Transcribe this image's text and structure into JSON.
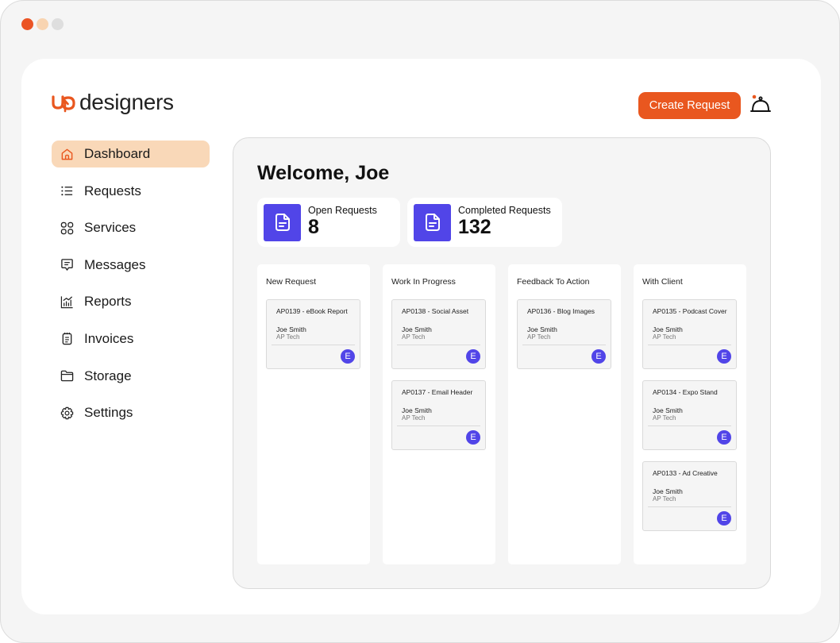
{
  "window": {
    "controls": [
      "close",
      "minimize",
      "maximize"
    ]
  },
  "brand": {
    "name": "designers",
    "mark": "up",
    "accent_color": "#e9571f",
    "primary_color": "#5145e8"
  },
  "header": {
    "create_button_label": "Create Request",
    "notification_icon": "service-bell-icon",
    "has_notification": true
  },
  "sidebar": {
    "items": [
      {
        "label": "Dashboard",
        "icon": "home-icon",
        "active": true
      },
      {
        "label": "Requests",
        "icon": "list-icon",
        "active": false
      },
      {
        "label": "Services",
        "icon": "grid-icon",
        "active": false
      },
      {
        "label": "Messages",
        "icon": "message-icon",
        "active": false
      },
      {
        "label": "Reports",
        "icon": "chart-icon",
        "active": false
      },
      {
        "label": "Invoices",
        "icon": "invoice-icon",
        "active": false
      },
      {
        "label": "Storage",
        "icon": "folder-icon",
        "active": false
      },
      {
        "label": "Settings",
        "icon": "gear-icon",
        "active": false
      }
    ]
  },
  "main": {
    "welcome": "Welcome, Joe",
    "stats": {
      "open": {
        "label": "Open Requests",
        "value": "8",
        "icon": "document-icon"
      },
      "completed": {
        "label": "Completed Requests",
        "value": "132",
        "icon": "document-icon"
      }
    },
    "columns": [
      {
        "title": "New Request",
        "cards": [
          {
            "title": "AP0139 - eBook Report",
            "name": "Joe Smith",
            "company": "AP Tech",
            "assignee": "E"
          }
        ]
      },
      {
        "title": "Work In Progress",
        "cards": [
          {
            "title": "AP0138 - Social Asset",
            "name": "Joe Smith",
            "company": "AP Tech",
            "assignee": "E"
          },
          {
            "title": "AP0137 - Email Header",
            "name": "Joe Smith",
            "company": "AP Tech",
            "assignee": "E"
          }
        ]
      },
      {
        "title": "Feedback To Action",
        "cards": [
          {
            "title": "AP0136 - Blog Images",
            "name": "Joe Smith",
            "company": "AP Tech",
            "assignee": "E"
          }
        ]
      },
      {
        "title": "With Client",
        "cards": [
          {
            "title": "AP0135 - Podcast Cover",
            "name": "Joe Smith",
            "company": "AP Tech",
            "assignee": "E"
          },
          {
            "title": "AP0134 - Expo Stand",
            "name": "Joe Smith",
            "company": "AP Tech",
            "assignee": "E"
          },
          {
            "title": "AP0133 - Ad Creative",
            "name": "Joe Smith",
            "company": "AP Tech",
            "assignee": "E"
          }
        ]
      }
    ]
  }
}
